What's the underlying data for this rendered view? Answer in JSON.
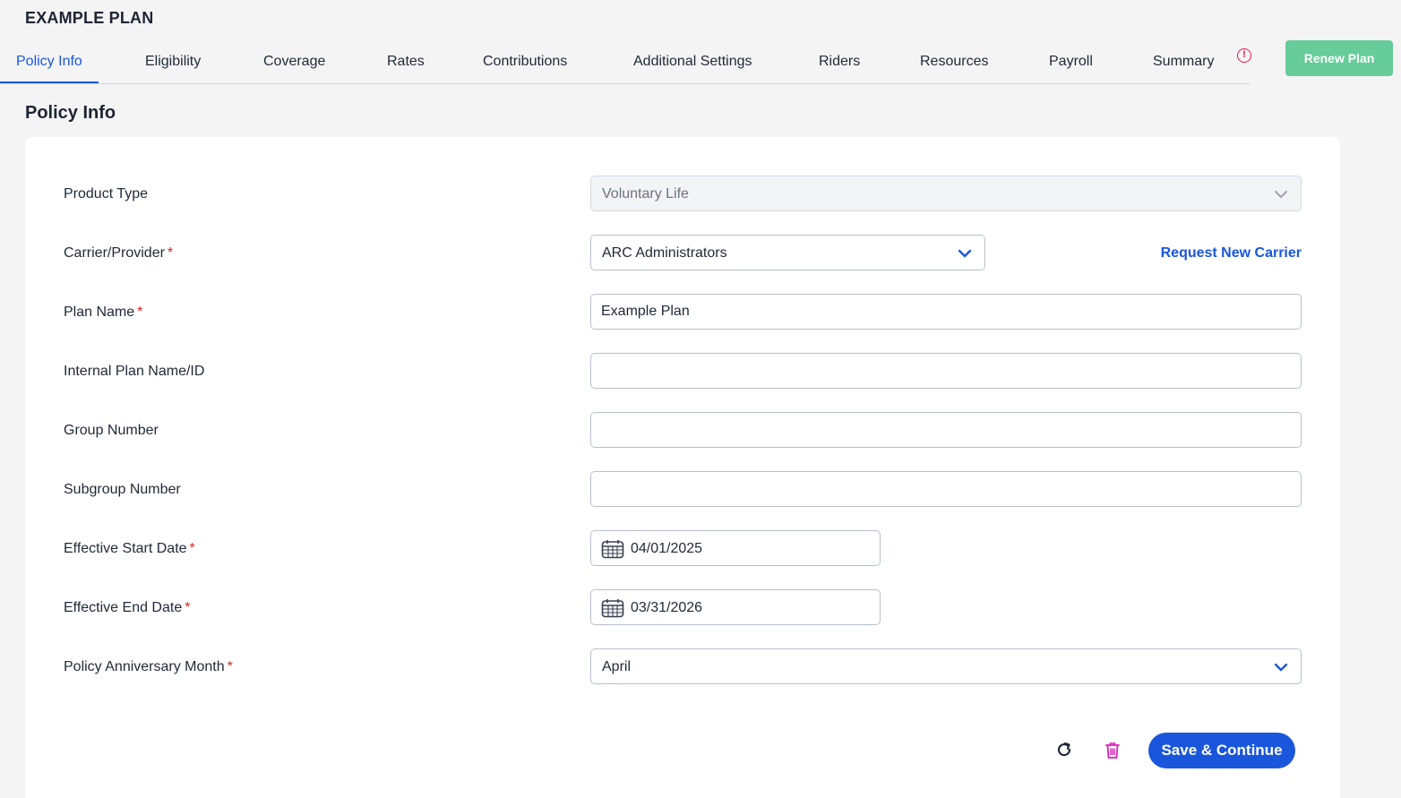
{
  "header": {
    "plan_title": "EXAMPLE PLAN",
    "renew_label": "Renew Plan"
  },
  "tabs": [
    {
      "label": "Policy Info",
      "active": true
    },
    {
      "label": "Eligibility"
    },
    {
      "label": "Coverage"
    },
    {
      "label": "Rates"
    },
    {
      "label": "Contributions"
    },
    {
      "label": "Additional Settings"
    },
    {
      "label": "Riders"
    },
    {
      "label": "Resources"
    },
    {
      "label": "Payroll"
    },
    {
      "label": "Summary"
    }
  ],
  "warning_icon": "alert-circle-icon",
  "section": {
    "title": "Policy Info"
  },
  "form": {
    "product_type": {
      "label": "Product Type",
      "value": "Voluntary Life"
    },
    "carrier": {
      "label": "Carrier/Provider",
      "value": "ARC Administrators",
      "link": "Request New Carrier"
    },
    "plan_name": {
      "label": "Plan Name",
      "value": "Example Plan"
    },
    "internal_name": {
      "label": "Internal Plan Name/ID",
      "value": ""
    },
    "group_number": {
      "label": "Group Number",
      "value": ""
    },
    "subgroup_number": {
      "label": "Subgroup Number",
      "value": ""
    },
    "start_date": {
      "label": "Effective Start Date",
      "value": "04/01/2025"
    },
    "end_date": {
      "label": "Effective End Date",
      "value": "03/31/2026"
    },
    "anniversary": {
      "label": "Policy Anniversary Month",
      "value": "April"
    },
    "required_mark": "*"
  },
  "actions": {
    "save_label": "Save & Continue"
  },
  "colors": {
    "primary": "#1a56db",
    "renew": "#66cc99",
    "required": "#dc2626",
    "delete": "#e11dbb"
  }
}
